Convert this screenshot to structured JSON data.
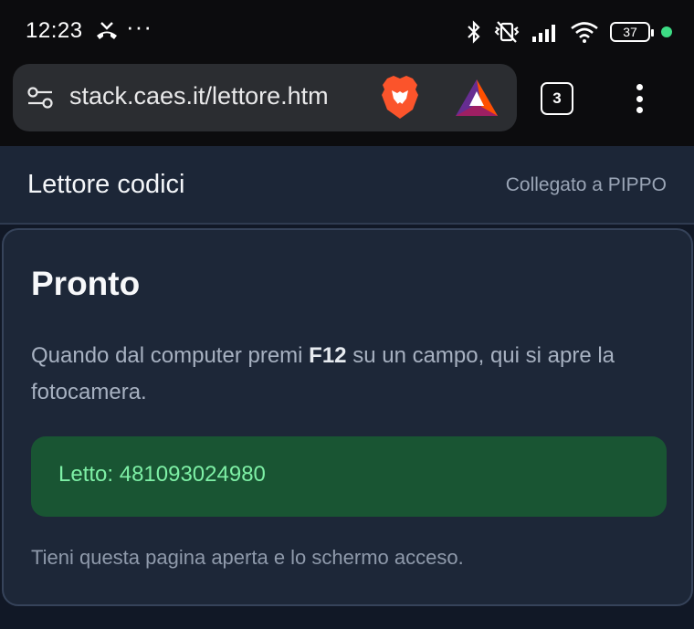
{
  "status_bar": {
    "time": "12:23",
    "more": "···",
    "battery": "37",
    "icons": [
      "missed-call-icon",
      "bluetooth-icon",
      "vibrate-off-icon",
      "signal-icon",
      "wifi-icon",
      "battery-icon",
      "charging-dot-icon"
    ]
  },
  "browser": {
    "url": "stack.caes.it/lettore.htm",
    "tab_count": "3",
    "icons": [
      "site-settings-icon",
      "brave-shields-icon",
      "bat-rewards-icon",
      "menu-icon"
    ]
  },
  "header": {
    "title": "Lettore codici",
    "connection": "Collegato a PIPPO"
  },
  "card": {
    "title": "Pronto",
    "desc_before": "Quando dal computer premi ",
    "desc_key": "F12",
    "desc_after": " su un campo, qui si apre la fotocamera.",
    "result": "Letto: 481093024980",
    "note": "Tieni questa pagina aperta e lo schermo acceso."
  },
  "colors": {
    "page_bg": "#111826",
    "header_bg": "#1c2637",
    "card_bg": "#1d2738",
    "result_bg": "#195533",
    "result_text": "#7ef0a6"
  }
}
